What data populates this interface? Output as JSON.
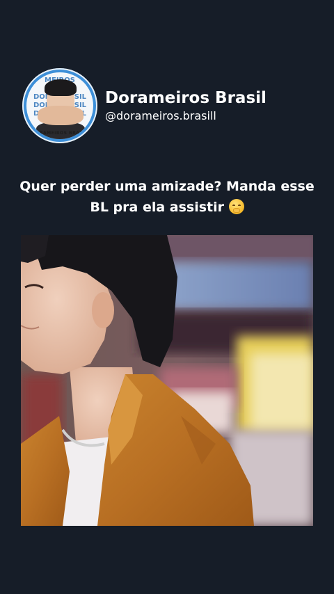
{
  "post": {
    "display_name": "Dorameiros Brasil",
    "handle": "@dorameiros.brasill",
    "caption_line1": "Quer perder uma amizade? Manda esse",
    "caption_line2": "BL pra ela assistir",
    "caption_emoji": "face-with-hand-over-mouth",
    "avatar": {
      "pattern_lines": [
        "MEIROS",
        "RASIL",
        "DORA BRASIL",
        "DORA BRASIL",
        "DORA BRASIL",
        "DORA"
      ],
      "ring_text": "DORAMEIROS BRASIL",
      "ring_color": "#3d8fd8"
    }
  },
  "media": {
    "type": "video-still",
    "description_icon": "man-in-orange-jacket-image"
  },
  "colors": {
    "background": "#161d28",
    "text": "#ffffff"
  }
}
